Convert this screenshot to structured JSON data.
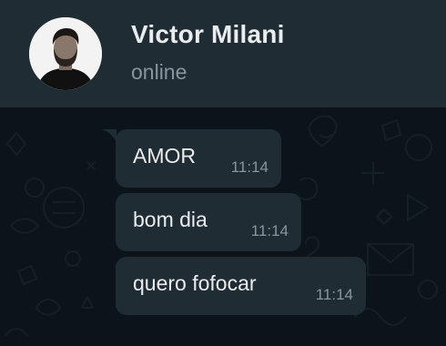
{
  "header": {
    "contact_name": "Victor Milani",
    "status": "online"
  },
  "messages": [
    {
      "text": "AMOR",
      "time": "11:14"
    },
    {
      "text": "bom dia",
      "time": "11:14"
    },
    {
      "text": "quero fofocar",
      "time": "11:14"
    }
  ],
  "colors": {
    "header_bg": "#1f2c34",
    "chat_bg": "#0b141a",
    "bubble_bg": "#202c33",
    "primary_text": "#e9edef",
    "secondary_text": "#8696a0"
  },
  "icons": [
    "avatar-photo",
    "chat-wallpaper-doodles"
  ]
}
